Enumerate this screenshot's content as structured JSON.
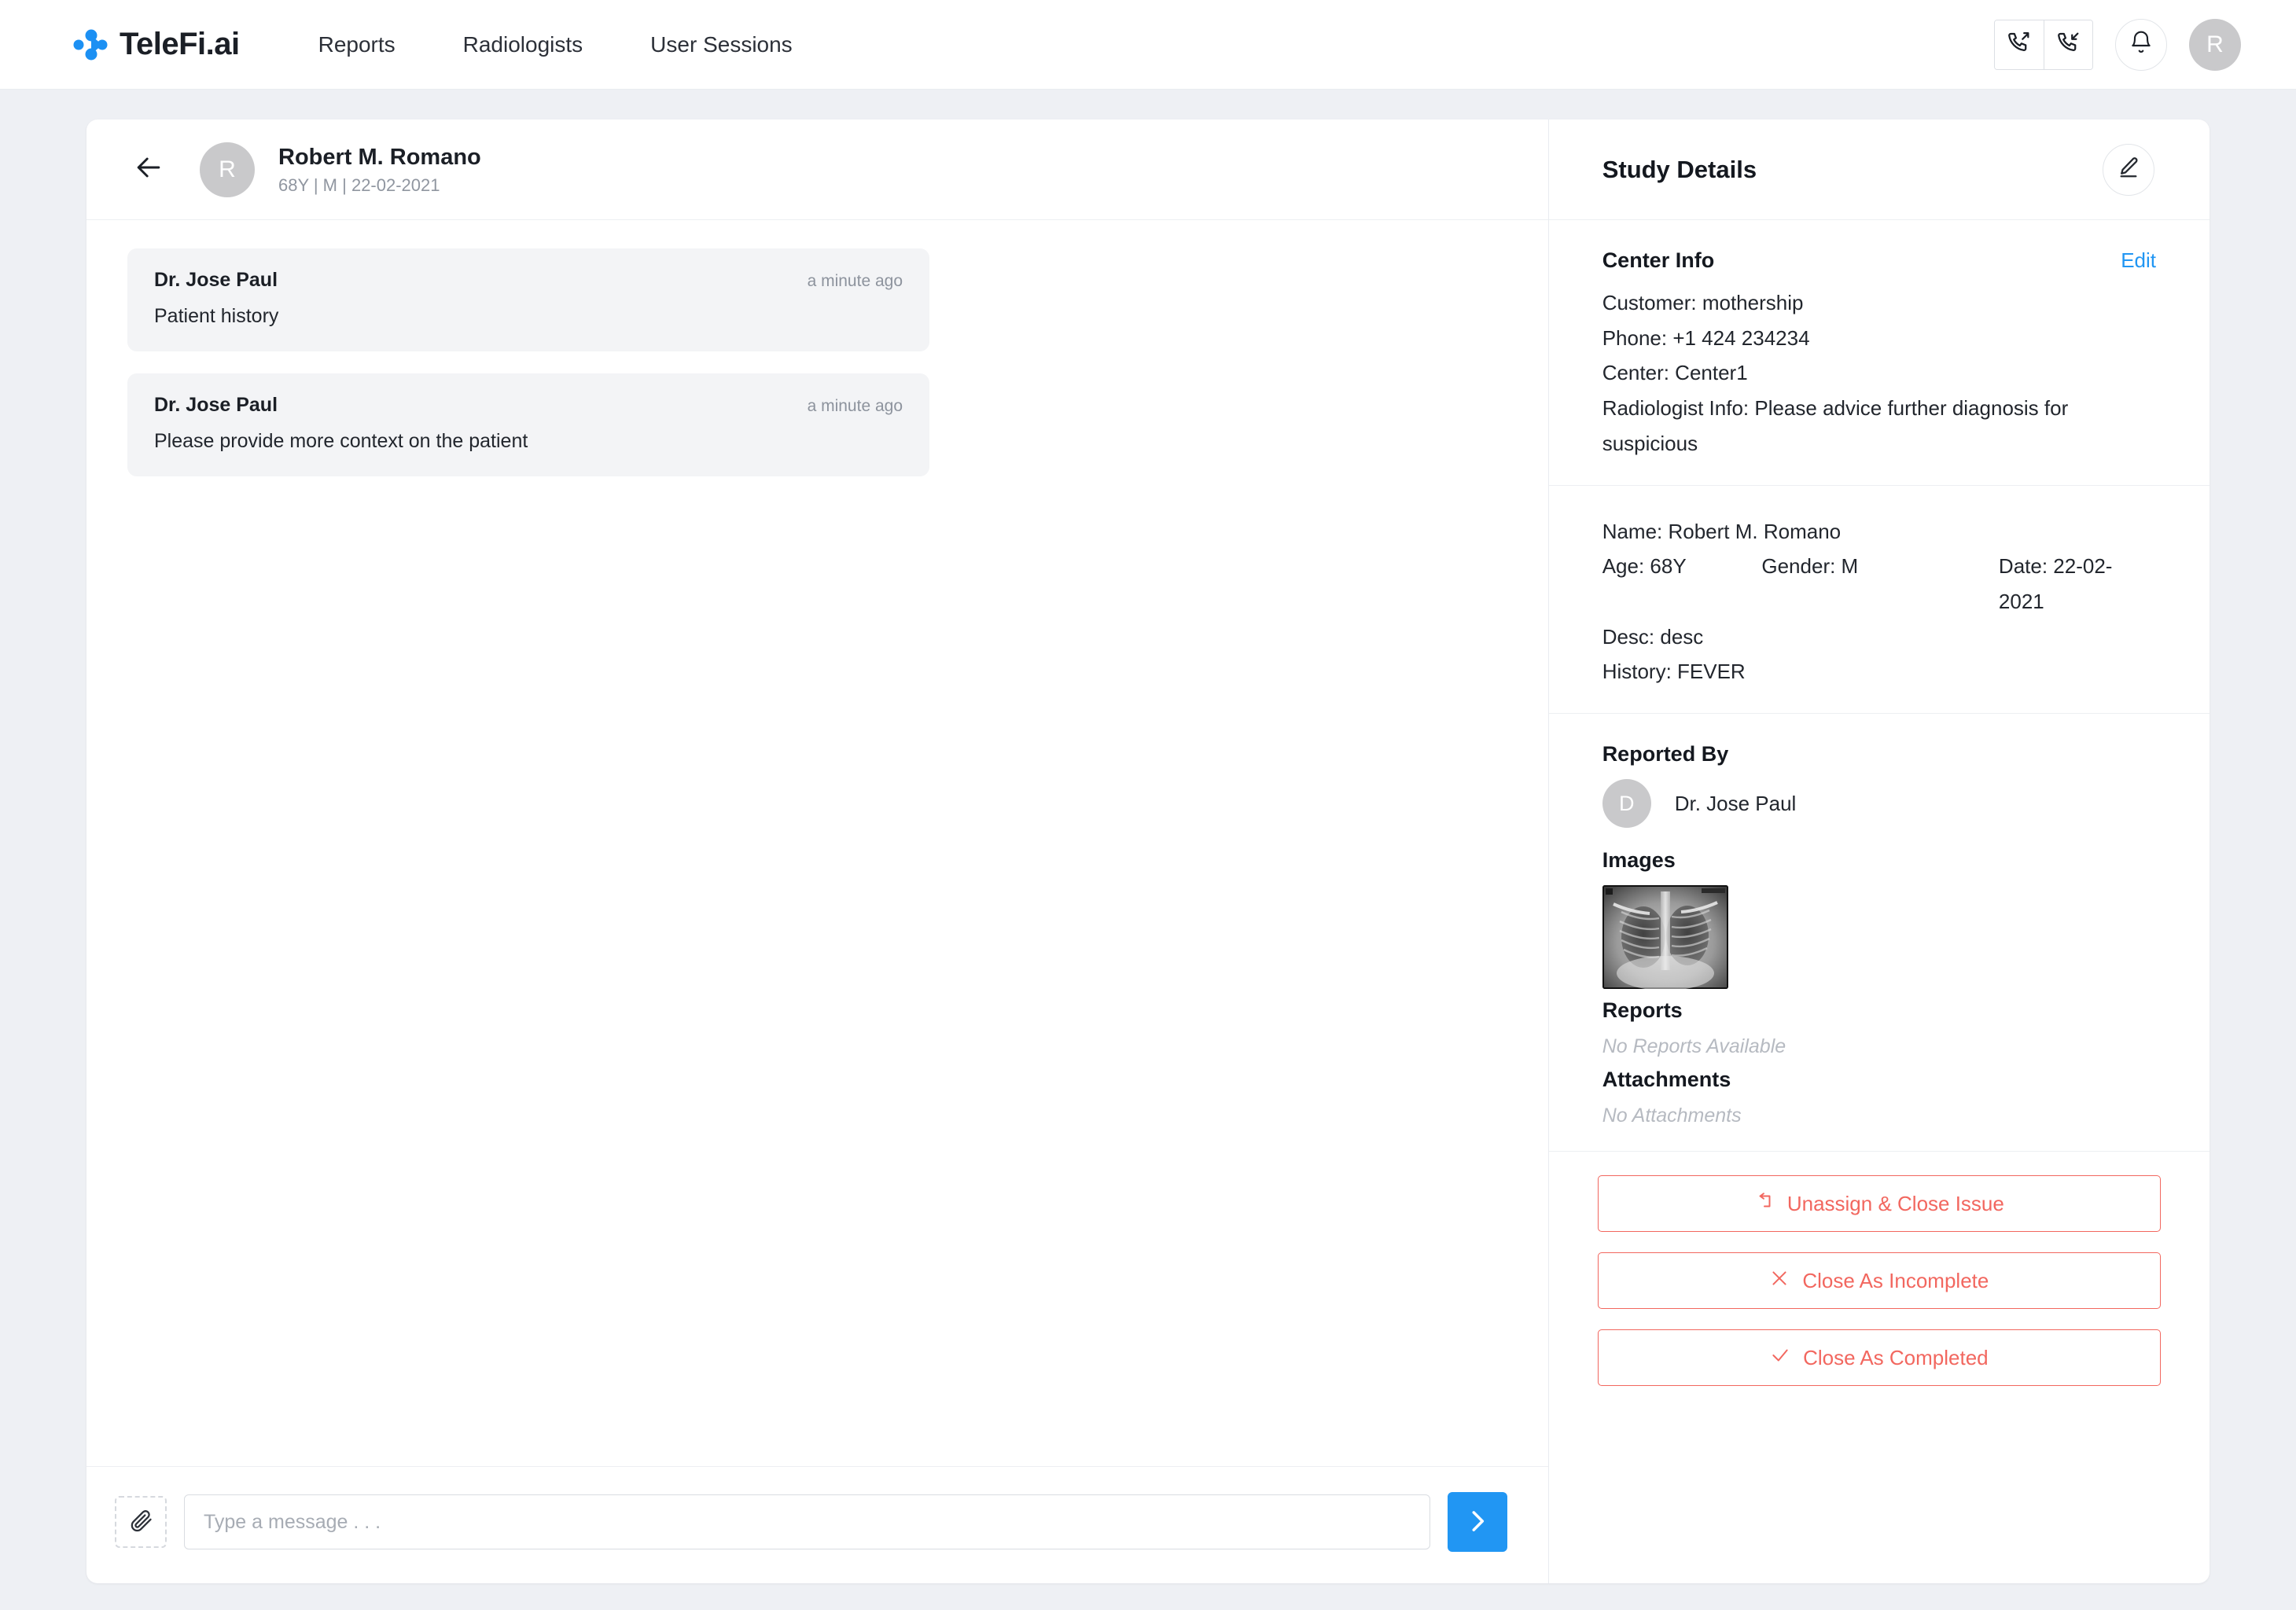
{
  "brand": {
    "name": "TeleFi.ai",
    "logo_icon": "telefi-logo-icon",
    "accent": "#2196f3"
  },
  "nav": {
    "links": [
      {
        "label": "Reports"
      },
      {
        "label": "Radiologists"
      },
      {
        "label": "User Sessions"
      }
    ],
    "actions": {
      "outgoing_call_icon": "phone-outgoing-icon",
      "incoming_call_icon": "phone-incoming-icon",
      "notification_icon": "bell-icon",
      "avatar_initial": "R"
    }
  },
  "chat": {
    "back_icon": "arrow-left-icon",
    "patient": {
      "avatar_initial": "R",
      "name": "Robert M. Romano",
      "meta": "68Y | M | 22-02-2021"
    },
    "messages": [
      {
        "author": "Dr. Jose Paul",
        "time": "a minute ago",
        "text": "Patient history"
      },
      {
        "author": "Dr. Jose Paul",
        "time": "a minute ago",
        "text": "Please provide more context on the patient"
      }
    ],
    "composer": {
      "attach_icon": "paperclip-icon",
      "placeholder": "Type a message . . .",
      "value": "",
      "send_icon": "chevron-right-icon"
    }
  },
  "study": {
    "title": "Study Details",
    "edit_icon": "pencil-icon",
    "center_info": {
      "title": "Center Info",
      "edit_label": "Edit",
      "lines": [
        "Customer: mothership",
        "Phone: +1 424 234234",
        "Center: Center1",
        "Radiologist Info: Please advice further diagnosis for suspicious"
      ]
    },
    "patient_info": {
      "name": "Name: Robert M. Romano",
      "age": "Age: 68Y",
      "gender": "Gender: M",
      "date": "Date: 22-02-2021",
      "desc": "Desc: desc",
      "history": "History: FEVER"
    },
    "reported_by": {
      "title": "Reported By",
      "avatar_initial": "D",
      "name": "Dr. Jose Paul"
    },
    "images": {
      "title": "Images",
      "thumbnail_alt": "chest-xray-thumbnail"
    },
    "reports": {
      "title": "Reports",
      "empty": "No Reports Available"
    },
    "attachments": {
      "title": "Attachments",
      "empty": "No Attachments"
    },
    "actions": [
      {
        "label": "Unassign & Close Issue",
        "icon": "unassign-icon"
      },
      {
        "label": "Close As Incomplete",
        "icon": "x-icon"
      },
      {
        "label": "Close As Completed",
        "icon": "check-icon"
      }
    ],
    "action_color": "#f2675f"
  }
}
